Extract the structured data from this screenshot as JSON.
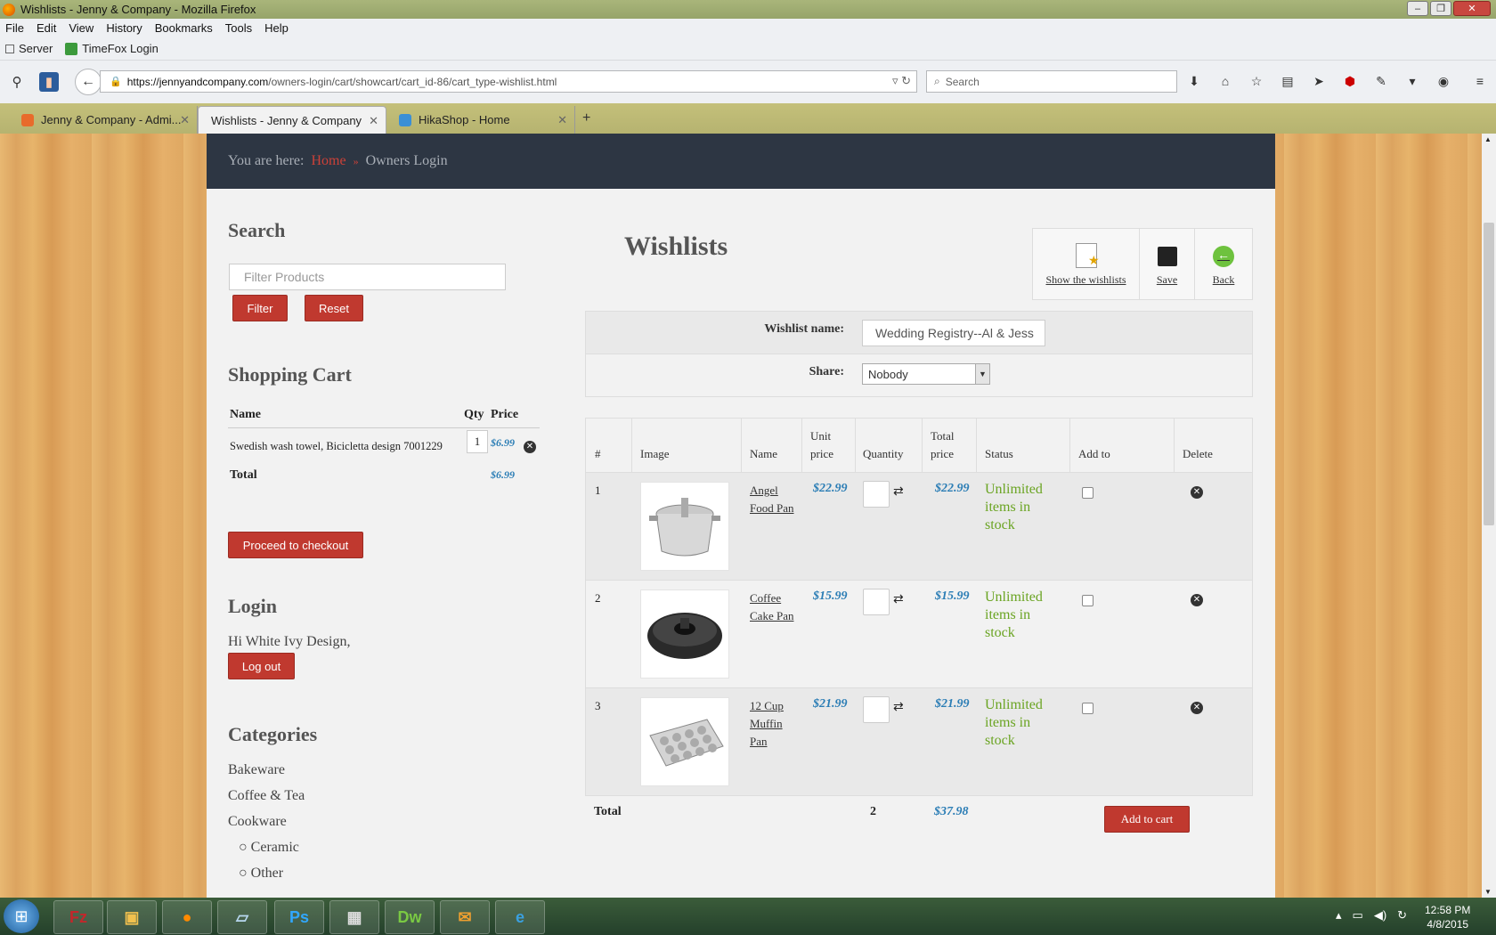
{
  "window": {
    "title": "Wishlists - Jenny & Company - Mozilla Firefox"
  },
  "menu": [
    "File",
    "Edit",
    "View",
    "History",
    "Bookmarks",
    "Tools",
    "Help"
  ],
  "bookmarks": {
    "server": "Server",
    "timefox": "TimeFox Login"
  },
  "url": {
    "domain": "https://jennyandcompany.com",
    "path": "/owners-login/cart/showcart/cart_id-86/cart_type-wishlist.html"
  },
  "search_placeholder": "Search",
  "tabs": [
    {
      "label": "Jenny & Company - Admi..."
    },
    {
      "label": "Wishlists - Jenny & Company"
    },
    {
      "label": "HikaShop - Home"
    }
  ],
  "breadcrumb": {
    "prefix": "You are here:",
    "home": "Home",
    "sep": "»",
    "current": "Owners Login"
  },
  "sidebar": {
    "search": {
      "title": "Search",
      "placeholder": "Filter Products",
      "filter_btn": "Filter",
      "reset_btn": "Reset"
    },
    "cart": {
      "title": "Shopping Cart",
      "col_name": "Name",
      "col_qty": "Qty",
      "col_price": "Price",
      "item_name": "Swedish wash towel, Bicicletta design 7001229",
      "item_qty": "1",
      "item_price": "$6.99",
      "total_label": "Total",
      "total_value": "$6.99",
      "checkout_btn": "Proceed to checkout"
    },
    "login": {
      "title": "Login",
      "greeting": "Hi White Ivy Design,",
      "logout_btn": "Log out"
    },
    "categories": {
      "title": "Categories",
      "items": [
        "Bakeware",
        "Coffee & Tea",
        "Cookware"
      ],
      "subitems": [
        "Ceramic",
        "Other"
      ]
    }
  },
  "main": {
    "title": "Wishlists",
    "tools": {
      "show": "Show the wishlists",
      "save": "Save",
      "back": "Back"
    },
    "form": {
      "name_label": "Wishlist name:",
      "name_value": "Wedding Registry--Al & Jess",
      "share_label": "Share:",
      "share_value": "Nobody"
    },
    "table": {
      "headers": {
        "num": "#",
        "image": "Image",
        "name": "Name",
        "unit1": "Unit",
        "unit2": "price",
        "qty": "Quantity",
        "total1": "Total",
        "total2": "price",
        "status": "Status",
        "addto": "Add to",
        "delete": "Delete"
      },
      "rows": [
        {
          "num": "1",
          "name1": "Angel",
          "name2": "Food Pan",
          "name3": "",
          "unit_price": "$22.99",
          "total_price": "$22.99",
          "status1": "Unlimited",
          "status2": "items in",
          "status3": "stock"
        },
        {
          "num": "2",
          "name1": "Coffee",
          "name2": "Cake Pan",
          "name3": "",
          "unit_price": "$15.99",
          "total_price": "$15.99",
          "status1": "Unlimited",
          "status2": "items in",
          "status3": "stock"
        },
        {
          "num": "3",
          "name1": "12 Cup",
          "name2": "Muffin",
          "name3": "Pan",
          "unit_price": "$21.99",
          "total_price": "$21.99",
          "status1": "Unlimited",
          "status2": "items in",
          "status3": "stock"
        }
      ],
      "footer": {
        "label": "Total",
        "qty": "2",
        "price": "$37.98",
        "addcart_btn": "Add to cart"
      }
    }
  },
  "clock": {
    "time": "12:58 PM",
    "date": "4/8/2015"
  },
  "colors": {
    "accent_red": "#c0392f",
    "price_blue": "#2b7db5",
    "stock_green": "#6aa422",
    "header_dark": "#2d3643"
  }
}
